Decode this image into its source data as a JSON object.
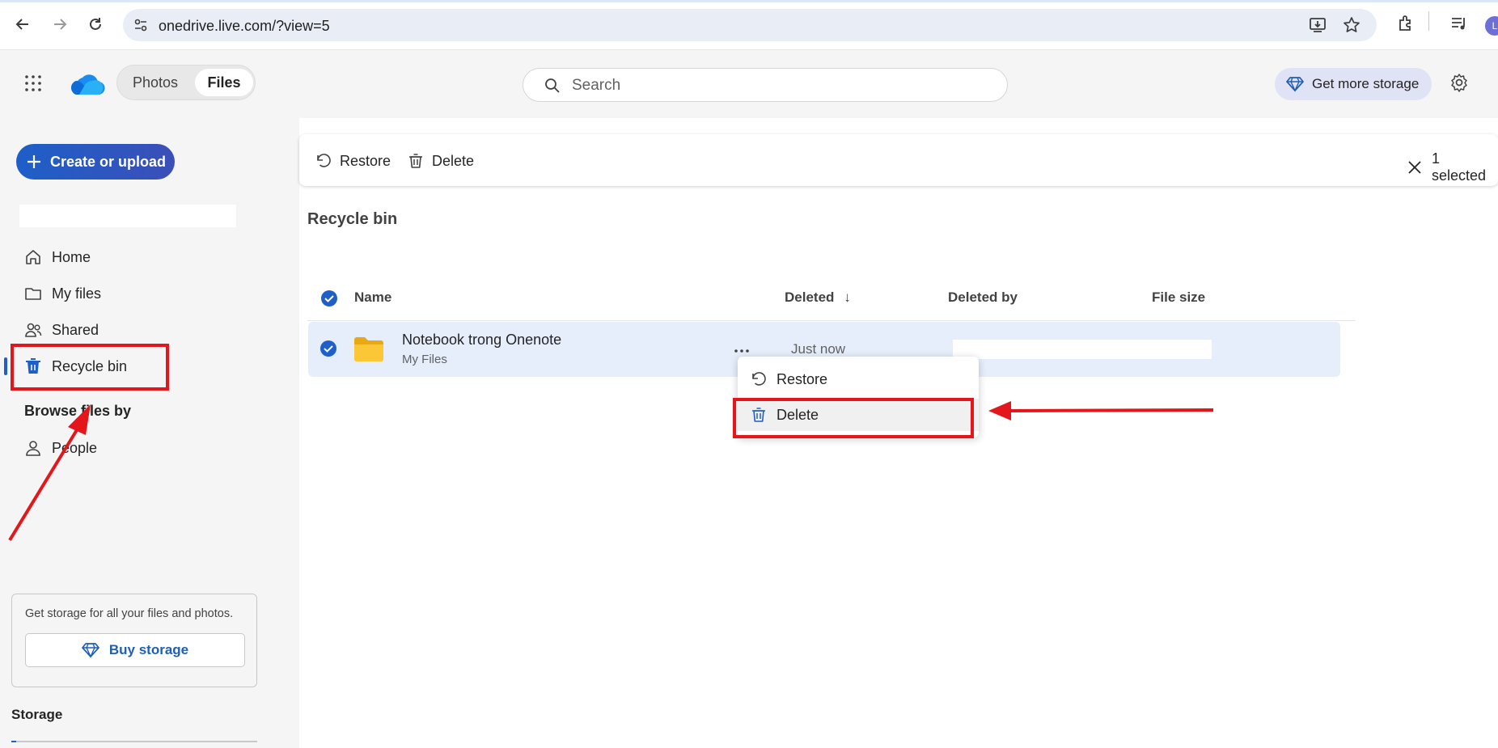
{
  "browser": {
    "url": "onedrive.live.com/?view=5",
    "profile_initial": "L"
  },
  "header": {
    "segments": {
      "photos": "Photos",
      "files": "Files"
    },
    "search_placeholder": "Search",
    "get_storage": "Get more storage"
  },
  "sidebar": {
    "create_label": "Create or upload",
    "items": [
      {
        "label": "Home",
        "icon": "home-icon"
      },
      {
        "label": "My files",
        "icon": "folder-icon"
      },
      {
        "label": "Shared",
        "icon": "people-icon"
      },
      {
        "label": "Recycle bin",
        "icon": "trash-icon",
        "active": true
      }
    ],
    "browse_label": "Browse files by",
    "browse_items": [
      {
        "label": "People",
        "icon": "person-icon"
      }
    ],
    "storage_card_text": "Get storage for all your files and photos.",
    "buy_storage": "Buy storage",
    "storage_label": "Storage"
  },
  "commandbar": {
    "restore": "Restore",
    "delete": "Delete",
    "selected": "1 selected"
  },
  "main": {
    "title": "Recycle bin",
    "columns": {
      "name": "Name",
      "deleted": "Deleted",
      "deleted_by": "Deleted by",
      "file_size": "File size"
    },
    "rows": [
      {
        "name": "Notebook trong Onenote",
        "location": "My Files",
        "deleted": "Just now"
      }
    ]
  },
  "context_menu": {
    "restore": "Restore",
    "delete": "Delete"
  },
  "colors": {
    "accent": "#1e5fc8",
    "annotation": "#e3161b",
    "selected_row": "#e6eefb"
  }
}
